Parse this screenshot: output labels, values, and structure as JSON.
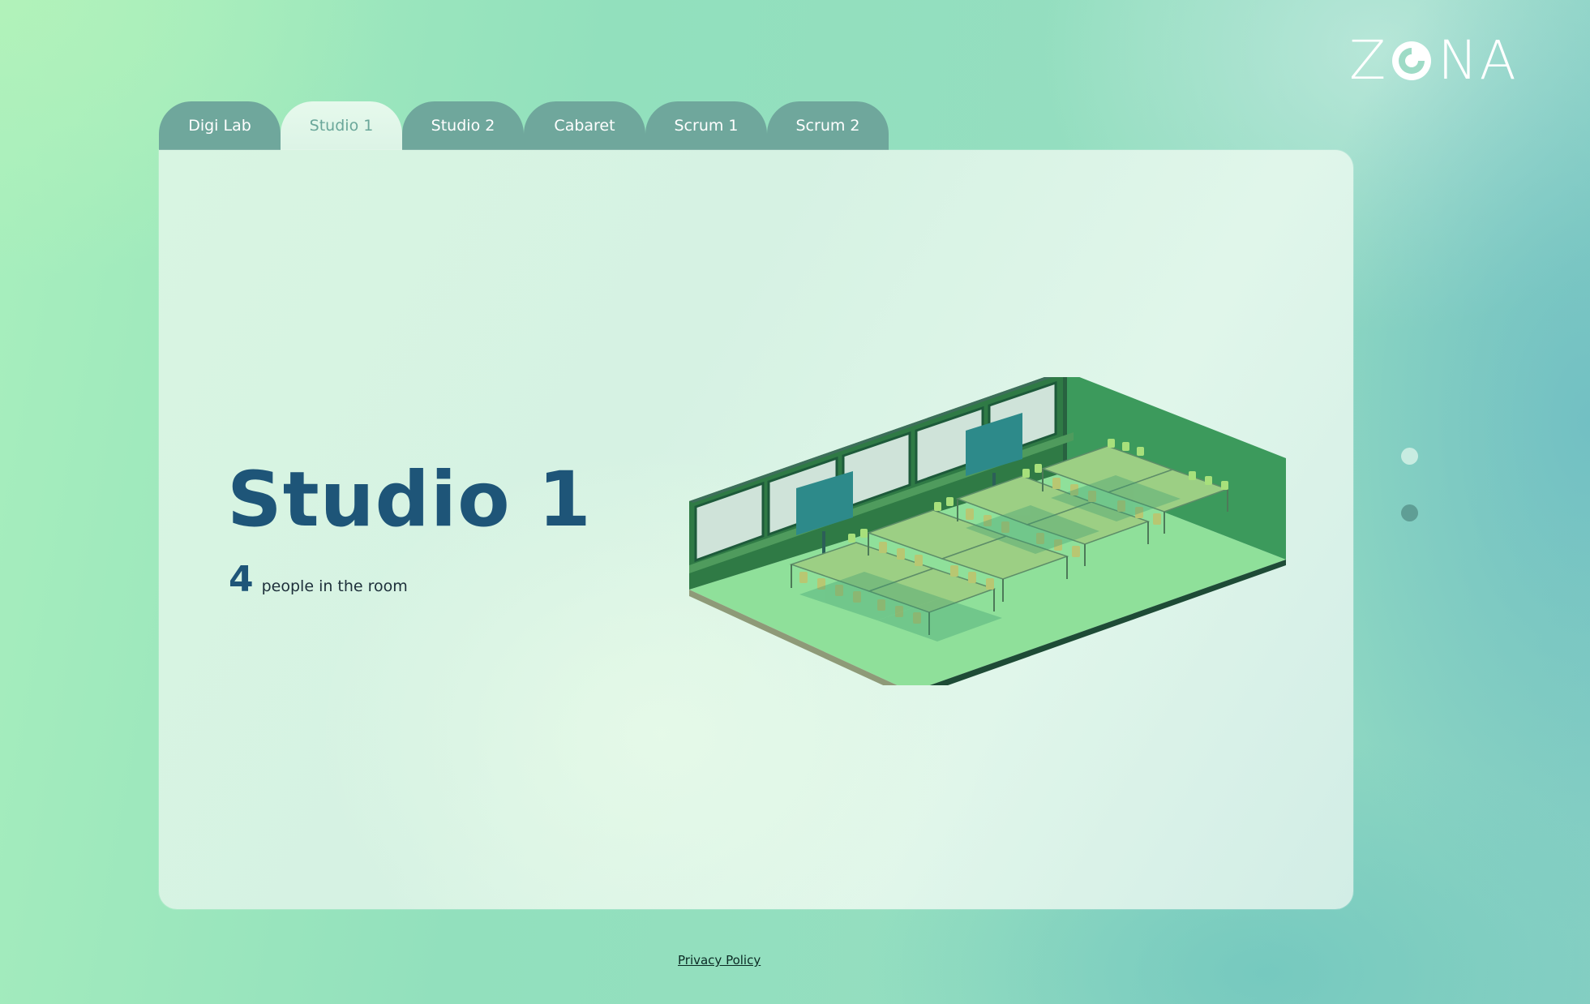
{
  "brand": {
    "logo_left": "Z",
    "logo_right": "NA",
    "logo_icon": "swirl-o-icon"
  },
  "tabs": [
    {
      "label": "Digi Lab",
      "active": false
    },
    {
      "label": "Studio 1",
      "active": true
    },
    {
      "label": "Studio 2",
      "active": false
    },
    {
      "label": "Cabaret",
      "active": false
    },
    {
      "label": "Scrum 1",
      "active": false
    },
    {
      "label": "Scrum 2",
      "active": false
    }
  ],
  "room": {
    "title": "Studio 1",
    "people_count": "4",
    "people_label": "people in the room",
    "illustration": "isometric-classroom-image"
  },
  "pager": {
    "pages": 2,
    "active_page": 2
  },
  "footer": {
    "privacy_link": "Privacy Policy"
  },
  "colors": {
    "title": "#1e5578",
    "tab_bg": "#6fa79c",
    "tab_active_bg": "#e0f6e8",
    "tab_active_text": "#6aa79a",
    "dot_inactive": "#c8ece1",
    "dot_active": "#5f9e95"
  }
}
